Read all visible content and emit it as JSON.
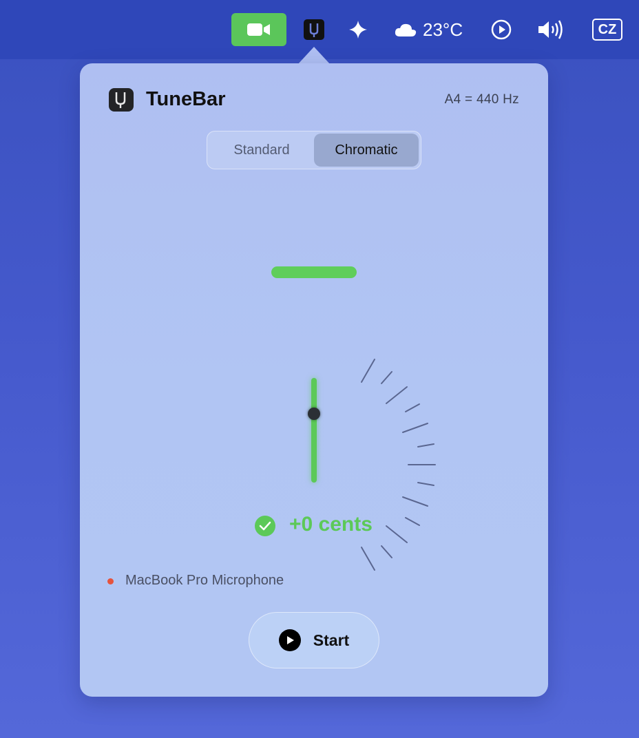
{
  "menubar": {
    "facetime_icon": "video-camera-icon",
    "tunebar_icon": "tuning-fork-icon",
    "sparkle_icon": "sparkle-icon",
    "weather_icon": "cloud-icon",
    "temperature": "23°C",
    "media_icon": "play-circle-icon",
    "volume_icon": "speaker-wave-icon",
    "input_language": "CZ"
  },
  "app": {
    "title": "TuneBar",
    "reference_pitch": "A4 = 440 Hz"
  },
  "mode_tabs": [
    {
      "label": "Standard",
      "active": false
    },
    {
      "label": "Chromatic",
      "active": true
    }
  ],
  "tuner": {
    "cents_offset": 0,
    "status_text": "+0 cents",
    "in_tune": true
  },
  "input_device": {
    "name": "MacBook Pro Microphone",
    "status_color": "#e5533d"
  },
  "start_button": {
    "label": "Start",
    "icon": "play-icon"
  },
  "colors": {
    "accent_green": "#5cc958",
    "menubar_bg": "#2f47b9",
    "popover_bg": "#b1c5f3"
  }
}
